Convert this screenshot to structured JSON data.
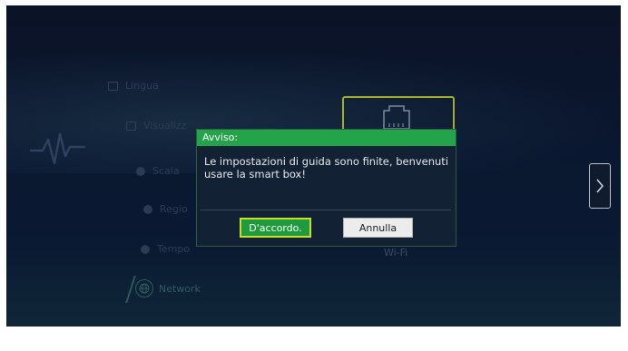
{
  "menu": {
    "items": [
      {
        "label": "Lingua",
        "icon": "language-icon"
      },
      {
        "label": "Visualizz",
        "icon": "display-icon"
      },
      {
        "label": "Scala",
        "icon": "scale-icon"
      },
      {
        "label": "Regio",
        "icon": "region-icon"
      },
      {
        "label": "Tempo",
        "icon": "clock-icon"
      },
      {
        "label": "Network",
        "icon": "globe-icon"
      }
    ],
    "active": "Network"
  },
  "content": {
    "wifi_label": "Wi-Fi",
    "card_icon": "ethernet-icon",
    "accent": "#a2ad2a"
  },
  "dialog": {
    "title": "Avviso:",
    "message": "Le impostazioni di guida sono finite, benvenuti usare la smart box!",
    "confirm_label": "D'accordo.",
    "cancel_label": "Annulla",
    "header_color": "#23a34a"
  },
  "nav": {
    "next_icon": "chevron-right-icon"
  }
}
